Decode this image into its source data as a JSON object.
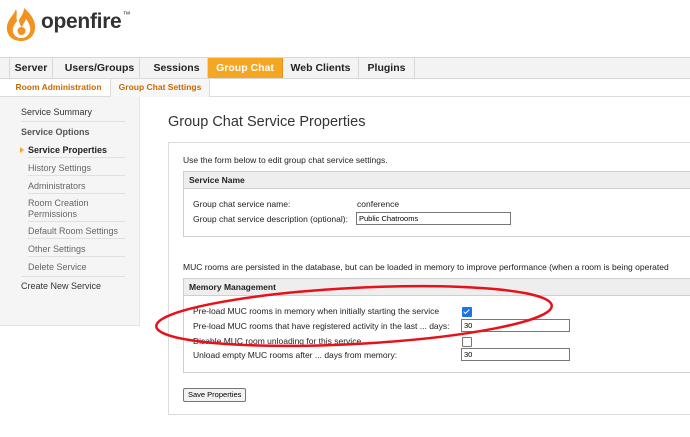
{
  "app": {
    "logo_text": "openfire",
    "logo_tm": "™"
  },
  "main_tabs": [
    {
      "label": "Server",
      "active": false
    },
    {
      "label": "Users/Groups",
      "active": false
    },
    {
      "label": "Sessions",
      "active": false
    },
    {
      "label": "Group Chat",
      "active": true
    },
    {
      "label": "Web Clients",
      "active": false
    },
    {
      "label": "Plugins",
      "active": false
    }
  ],
  "sub_tabs": [
    {
      "label": "Room Administration",
      "active": false
    },
    {
      "label": "Group Chat Settings",
      "active": true
    }
  ],
  "sidebar": {
    "items": [
      {
        "label": "Service Summary"
      },
      {
        "label": "Service Options"
      },
      {
        "label": "Service Properties"
      },
      {
        "label": "History Settings"
      },
      {
        "label": "Administrators"
      },
      {
        "label": "Room Creation Permissions"
      },
      {
        "label": "Default Room Settings"
      },
      {
        "label": "Other Settings"
      },
      {
        "label": "Delete Service"
      },
      {
        "label": "Create New Service"
      }
    ]
  },
  "main": {
    "title": "Group Chat Service Properties",
    "intro": "Use the form below to edit group chat service settings.",
    "service_name": {
      "header": "Service Name",
      "name_label": "Group chat service name:",
      "name_value": "conference",
      "desc_label": "Group chat service description (optional):",
      "desc_value": "Public Chatrooms"
    },
    "muc_note": "MUC rooms are persisted in the database, but can be loaded in memory to improve performance (when a room is being operated",
    "memory": {
      "header": "Memory Management",
      "preload_label": "Pre-load MUC rooms in memory when initially starting the service",
      "preload_checked": true,
      "preload_activity_label": "Pre-load MUC rooms that have registered activity in the last ... days:",
      "preload_activity_value": "30",
      "disable_unload_label": "Disable MUC room unloading for this service",
      "disable_unload_checked": false,
      "unload_empty_label": "Unload empty MUC rooms after ... days from memory:",
      "unload_empty_value": "30"
    },
    "save_button": "Save Properties"
  },
  "colors": {
    "accent": "#f5a623",
    "link": "#c86a00",
    "highlight": "#e8111a",
    "checkbox": "#1a73e8"
  }
}
